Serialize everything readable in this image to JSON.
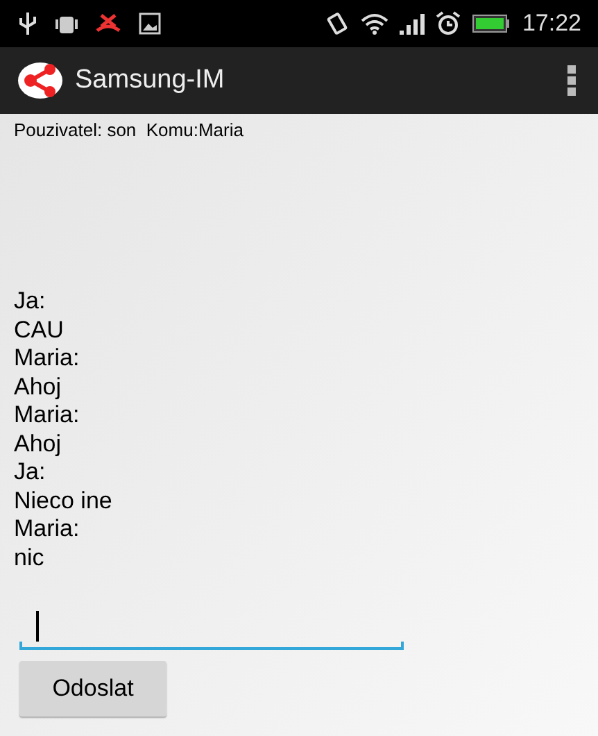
{
  "status_bar": {
    "time": "17:22"
  },
  "app_bar": {
    "title": "Samsung-IM"
  },
  "header": "Pouzivatel: son  Komu:Maria",
  "messages": [
    {
      "sender": "Ja:",
      "text": "CAU"
    },
    {
      "sender": "Maria:",
      "text": "Ahoj"
    },
    {
      "sender": "Maria:",
      "text": "Ahoj"
    },
    {
      "sender": "Ja:",
      "text": "Nieco ine"
    },
    {
      "sender": "Maria:",
      "text": "nic"
    }
  ],
  "send_button": "Odoslat"
}
